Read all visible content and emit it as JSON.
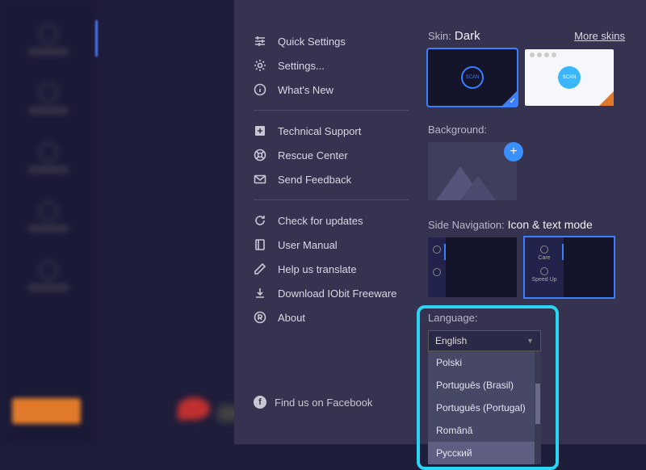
{
  "menu": {
    "items": [
      {
        "icon": "sliders",
        "label": "Quick Settings"
      },
      {
        "icon": "gear",
        "label": "Settings..."
      },
      {
        "icon": "info",
        "label": "What's New"
      }
    ],
    "support": [
      {
        "icon": "plus-box",
        "label": "Technical Support"
      },
      {
        "icon": "life-ring",
        "label": "Rescue Center"
      },
      {
        "icon": "mail",
        "label": "Send Feedback"
      }
    ],
    "extra": [
      {
        "icon": "refresh",
        "label": "Check for updates"
      },
      {
        "icon": "book",
        "label": "User Manual"
      },
      {
        "icon": "pencil",
        "label": "Help us translate"
      },
      {
        "icon": "download",
        "label": "Download IObit Freeware"
      },
      {
        "icon": "registered",
        "label": "About"
      }
    ],
    "facebook": "Find us on Facebook"
  },
  "skin": {
    "label": "Skin:",
    "value": "Dark",
    "more": "More skins",
    "scan": "SCAN"
  },
  "background": {
    "label": "Background:"
  },
  "sidenav": {
    "label": "Side Navigation:",
    "value": "Icon & text mode",
    "care": "Care",
    "speedup": "Speed Up"
  },
  "language": {
    "label": "Language:",
    "selected": "English",
    "options": [
      "Polski",
      "Português (Brasil)",
      "Português (Portugal)",
      "Română",
      "Русский"
    ]
  }
}
